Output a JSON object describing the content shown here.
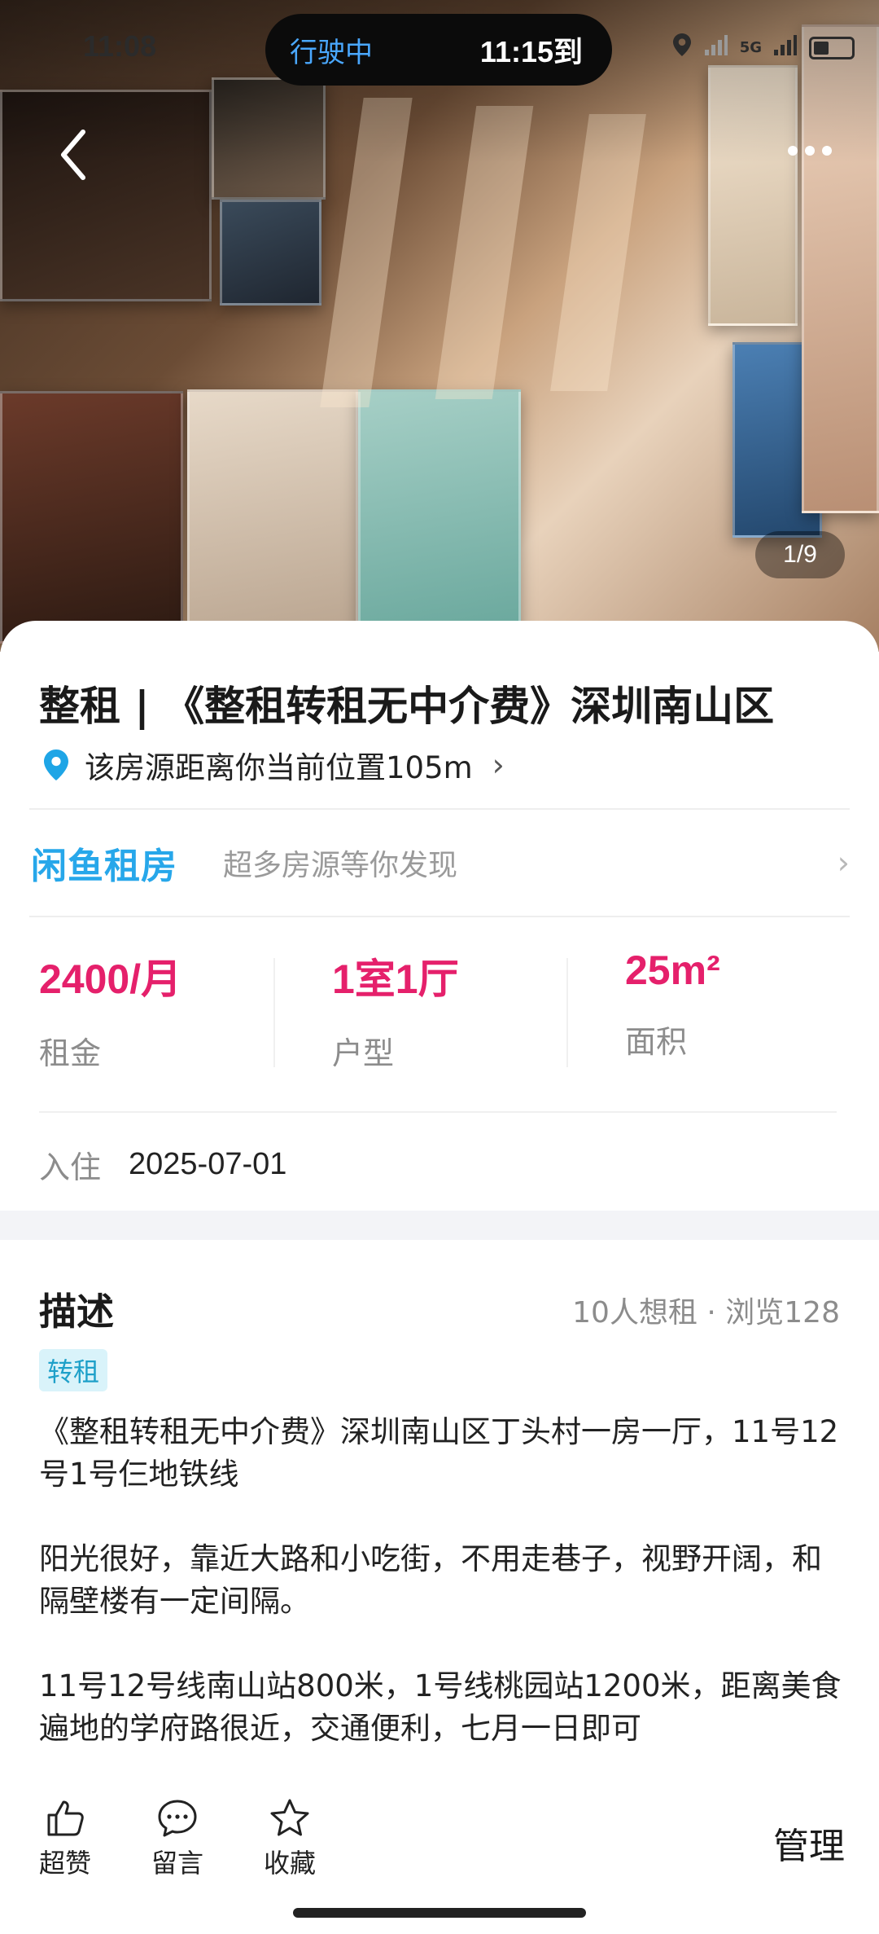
{
  "status_bar": {
    "time": "11:08",
    "nav_label": "行驶中",
    "eta": "11:15到",
    "network": "5G"
  },
  "gallery": {
    "counter": "1/9",
    "back_icon": "chevron-left-icon",
    "more_icon": "more-dots-icon"
  },
  "listing": {
    "title": "整租 | 《整租转租无中介费》深圳南山区",
    "location_text": "该房源距离你当前位置105m",
    "banner": {
      "brand": "闲鱼租房",
      "slogan": "超多房源等你发现"
    },
    "stats": [
      {
        "value": "2400/月",
        "label": "租金"
      },
      {
        "value": "1室1厅",
        "label": "户型"
      },
      {
        "value": "25m²",
        "label": "面积"
      }
    ],
    "move_in": {
      "label": "入住",
      "value": "2025-07-01"
    }
  },
  "description": {
    "heading": "描述",
    "meta": "10人想租 · 浏览128",
    "tag": "转租",
    "paragraphs": [
      "《整租转租无中介费》深圳南山区丁头村一房一厅，11号12号1号仨地铁线",
      "阳光很好，靠近大路和小吃街，不用走巷子，视野开阔，和隔壁楼有一定间隔。",
      "11号12号线南山站800米，1号线桃园站1200米，距离美食遍地的学府路很近，交通便利，七月一日即可"
    ]
  },
  "actions": {
    "like": "超赞",
    "comment": "留言",
    "favorite": "收藏",
    "manage": "管理"
  },
  "colors": {
    "accent": "#e5206b",
    "brand": "#27a7ea",
    "tag_bg": "#d9f3fa",
    "nav_blue": "#4aa8ff"
  }
}
